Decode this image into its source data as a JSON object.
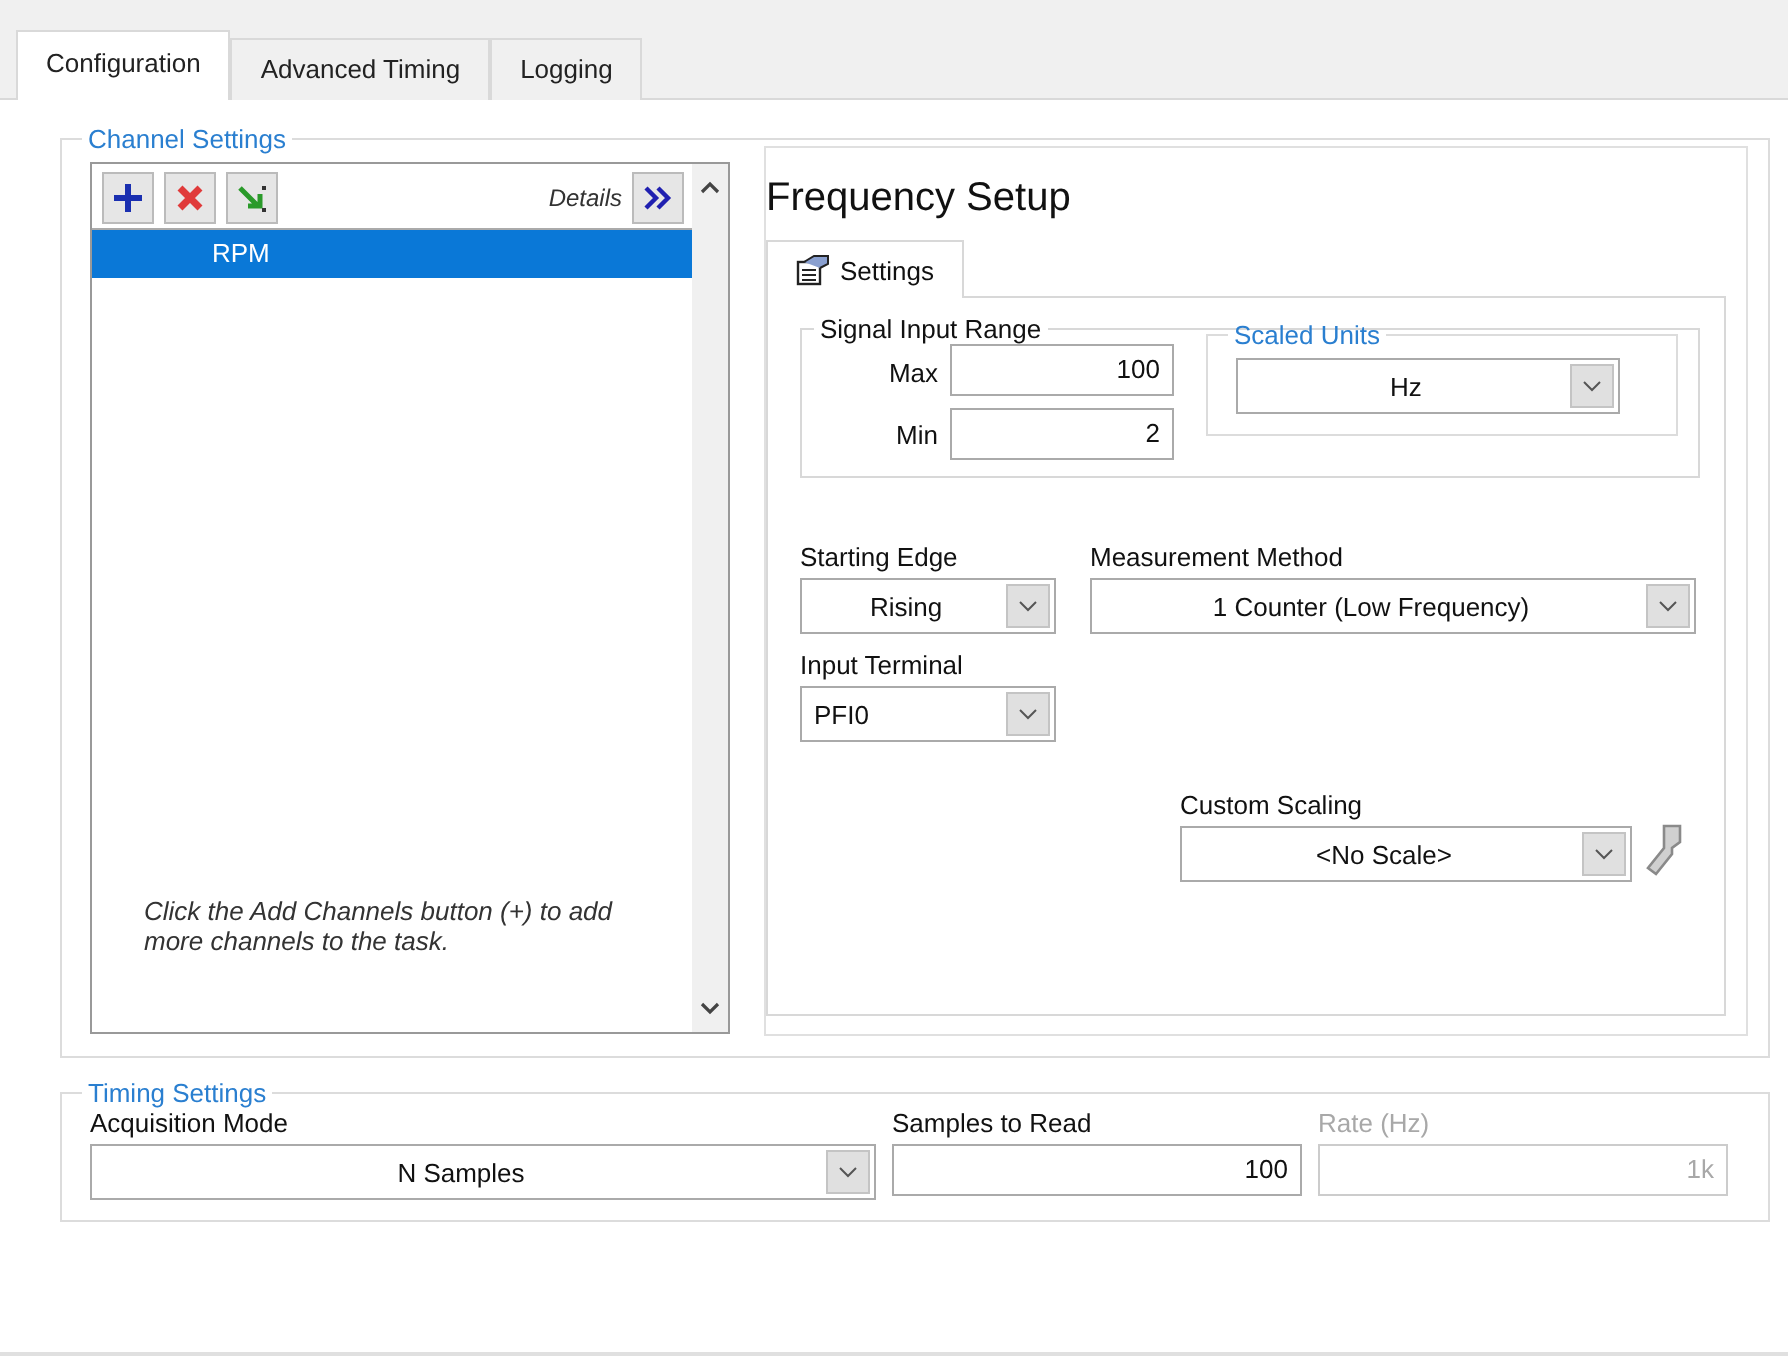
{
  "tabs": [
    {
      "label": "Configuration",
      "selected": true
    },
    {
      "label": "Advanced Timing",
      "selected": false
    },
    {
      "label": "Logging",
      "selected": false
    }
  ],
  "channel_settings": {
    "title": "Channel Settings",
    "details_label": "Details",
    "channels": [
      {
        "name": "RPM",
        "selected": true
      }
    ],
    "hint": "Click the Add Channels button (+) to add more channels to the task."
  },
  "frequency_setup": {
    "title": "Frequency Setup",
    "tab": "Settings",
    "signal_input_range": {
      "title": "Signal Input Range",
      "max_label": "Max",
      "max": "100",
      "min_label": "Min",
      "min": "2"
    },
    "scaled_units": {
      "title": "Scaled Units",
      "value": "Hz"
    },
    "starting_edge": {
      "label": "Starting Edge",
      "value": "Rising"
    },
    "measurement_method": {
      "label": "Measurement Method",
      "value": "1 Counter (Low Frequency)"
    },
    "input_terminal": {
      "label": "Input Terminal",
      "value": "PFI0"
    },
    "custom_scaling": {
      "label": "Custom Scaling",
      "value": "<No Scale>"
    }
  },
  "timing_settings": {
    "title": "Timing Settings",
    "acquisition_mode": {
      "label": "Acquisition Mode",
      "value": "N Samples"
    },
    "samples_to_read": {
      "label": "Samples to Read",
      "value": "100"
    },
    "rate": {
      "label": "Rate (Hz)",
      "value": "1k",
      "disabled": true
    }
  }
}
